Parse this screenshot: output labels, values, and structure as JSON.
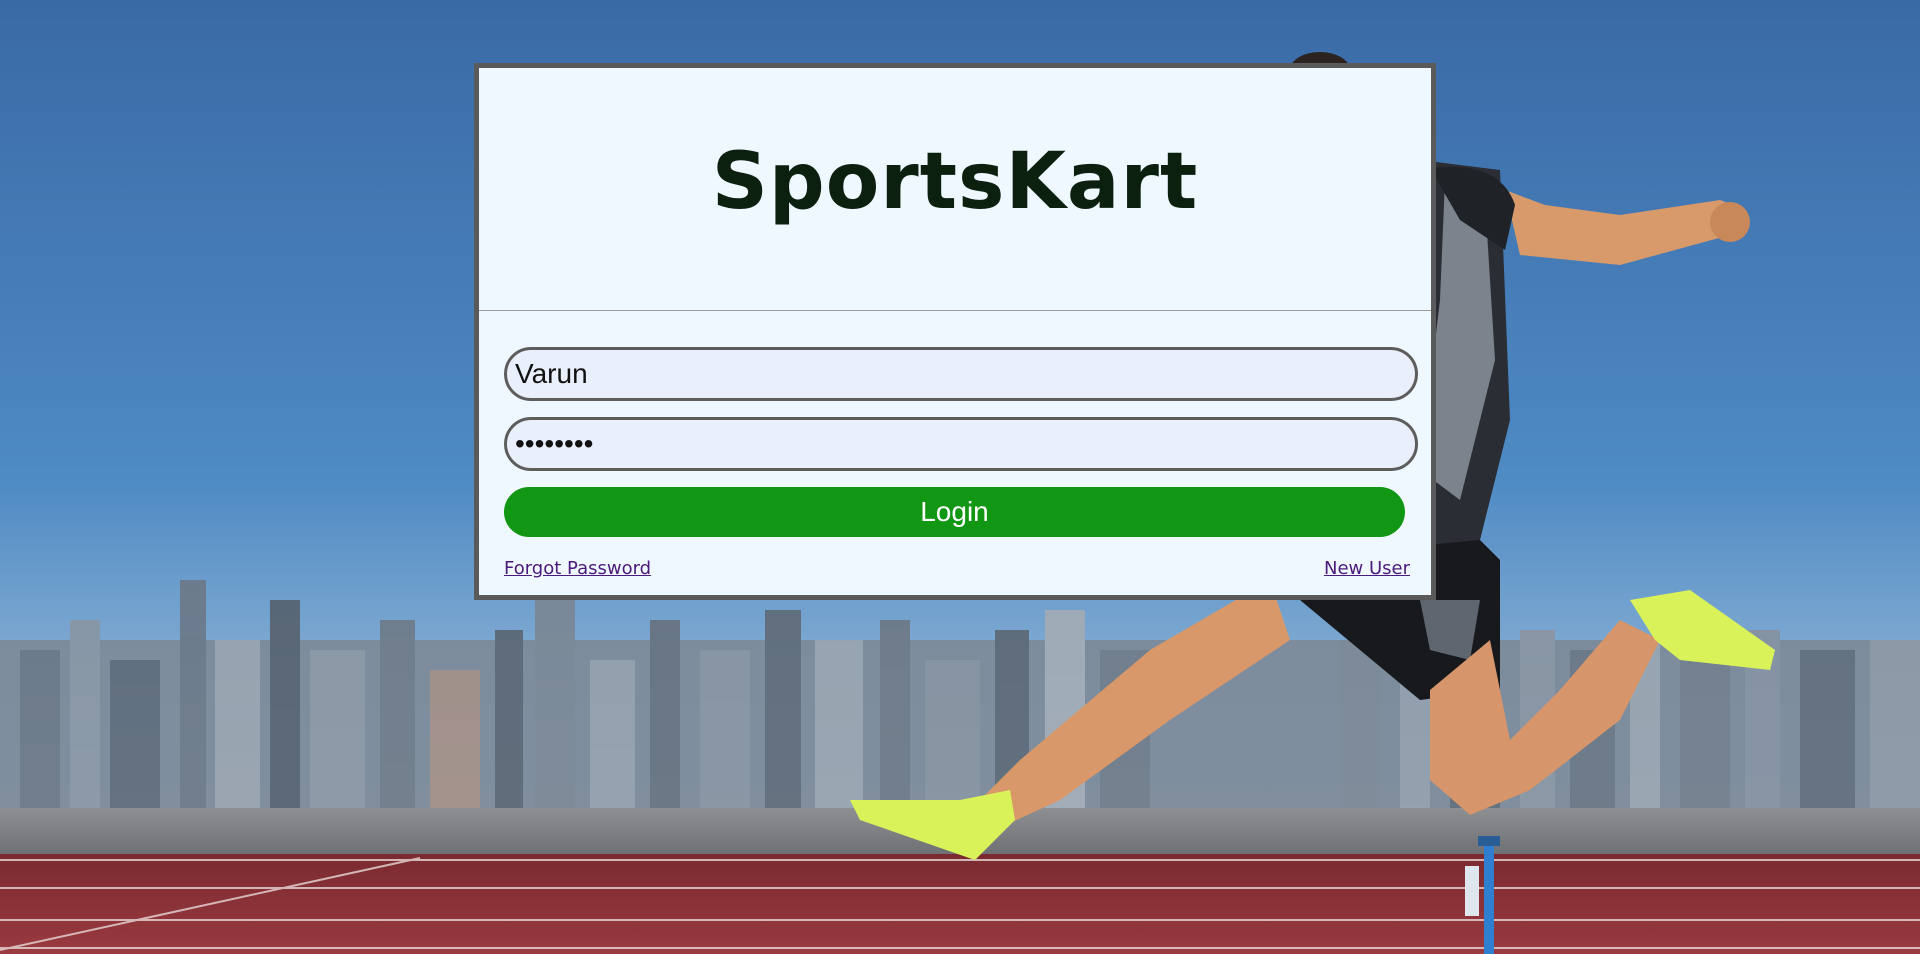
{
  "brand": {
    "title": "SportsKart"
  },
  "login_form": {
    "username_value": "Varun",
    "password_value": "password",
    "login_label": "Login",
    "forgot_password_label": "Forgot Password",
    "new_user_label": "New User"
  },
  "colors": {
    "sky": "#3d72ad",
    "card_background": "#eff8ff",
    "card_border": "#5a5a5a",
    "login_button": "#119713",
    "brand_text": "#0b200f",
    "link": "#4b1a7a",
    "track": "#8a2f35"
  }
}
